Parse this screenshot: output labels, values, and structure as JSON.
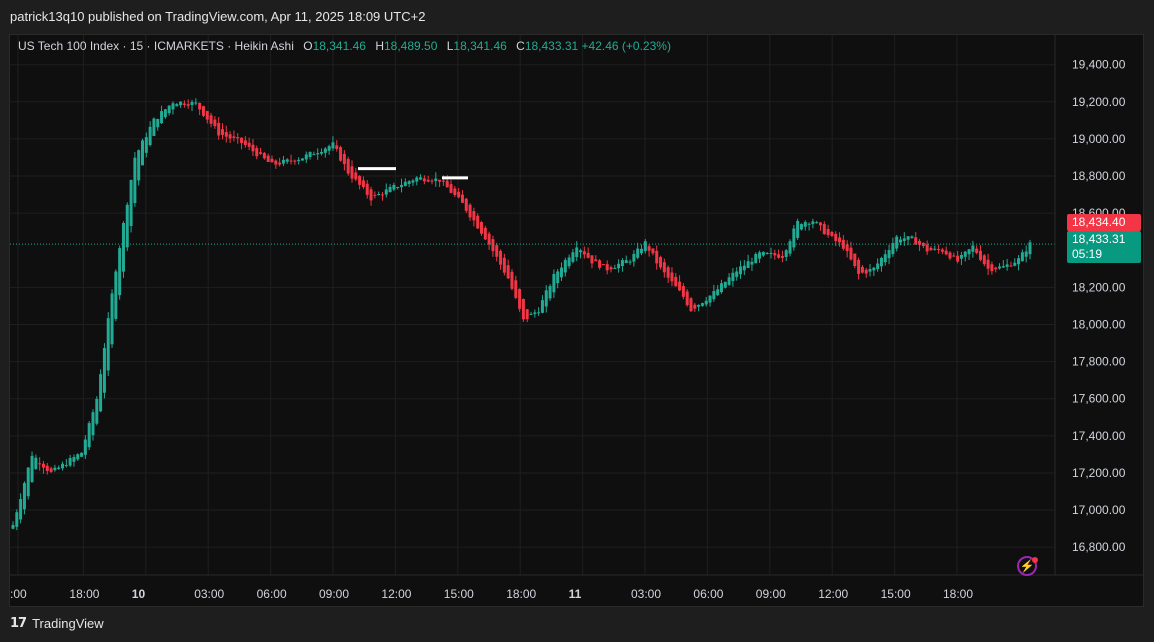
{
  "header": {
    "published": "patrick13q10 published on TradingView.com, Apr 11, 2025 18:09 UTC+2"
  },
  "legend": {
    "symbol": "US Tech 100 Index · 15 · ICMARKETS · Heikin Ashi",
    "o_label": "O",
    "o_value": "18,341.46",
    "h_label": "H",
    "h_value": "18,489.50",
    "l_label": "L",
    "l_value": "18,341.46",
    "c_label": "C",
    "c_value": "18,433.31",
    "change": "+42.46 (+0.23%)"
  },
  "price_tags": {
    "red_value": "18,434.40",
    "green_value": "18,433.31",
    "countdown": "05:19"
  },
  "footer": {
    "brand": "TradingView",
    "logo": "17"
  },
  "colors": {
    "up": "#22ab94",
    "down": "#f23645",
    "background": "#0f0f0f",
    "grid": "#1f1f1f"
  },
  "chart_data": {
    "type": "candlestick",
    "style": "Heikin Ashi",
    "interval": "15",
    "ylim": [
      16650,
      19560
    ],
    "y_ticks": [
      "19,400.00",
      "19,200.00",
      "19,000.00",
      "18,800.00",
      "18,600.00",
      "18,200.00",
      "18,000.00",
      "17,800.00",
      "17,600.00",
      "17,400.00",
      "17,200.00",
      "17,000.00",
      "16,800.00"
    ],
    "y_tick_values": [
      19400,
      19200,
      19000,
      18800,
      18600,
      18200,
      18000,
      17800,
      17600,
      17400,
      17200,
      17000,
      16800
    ],
    "x_ticks": [
      {
        "label": ":00",
        "bold": false
      },
      {
        "label": "18:00",
        "bold": false
      },
      {
        "label": "10",
        "bold": true
      },
      {
        "label": "03:00",
        "bold": false
      },
      {
        "label": "06:00",
        "bold": false
      },
      {
        "label": "09:00",
        "bold": false
      },
      {
        "label": "12:00",
        "bold": false
      },
      {
        "label": "15:00",
        "bold": false
      },
      {
        "label": "18:00",
        "bold": false
      },
      {
        "label": "11",
        "bold": true
      },
      {
        "label": "03:00",
        "bold": false
      },
      {
        "label": "06:00",
        "bold": false
      },
      {
        "label": "09:00",
        "bold": false
      },
      {
        "label": "12:00",
        "bold": false
      },
      {
        "label": "15:00",
        "bold": false
      },
      {
        "label": "18:00",
        "bold": false
      }
    ],
    "last_price": 18433.31,
    "horizontal_marks": [
      {
        "price": 18840,
        "label": "level-1"
      },
      {
        "price": 18790,
        "label": "level-2"
      }
    ],
    "anchors": [
      {
        "i": 0,
        "p": 16920
      },
      {
        "i": 5,
        "p": 17300
      },
      {
        "i": 10,
        "p": 17200
      },
      {
        "i": 18,
        "p": 17310
      },
      {
        "i": 22,
        "p": 17600
      },
      {
        "i": 27,
        "p": 18300
      },
      {
        "i": 32,
        "p": 18900
      },
      {
        "i": 37,
        "p": 19100
      },
      {
        "i": 42,
        "p": 19200
      },
      {
        "i": 48,
        "p": 19190
      },
      {
        "i": 54,
        "p": 19030
      },
      {
        "i": 60,
        "p": 18980
      },
      {
        "i": 68,
        "p": 18860
      },
      {
        "i": 76,
        "p": 18900
      },
      {
        "i": 84,
        "p": 18970
      },
      {
        "i": 88,
        "p": 18820
      },
      {
        "i": 94,
        "p": 18680
      },
      {
        "i": 100,
        "p": 18740
      },
      {
        "i": 106,
        "p": 18790
      },
      {
        "i": 112,
        "p": 18780
      },
      {
        "i": 118,
        "p": 18650
      },
      {
        "i": 124,
        "p": 18470
      },
      {
        "i": 130,
        "p": 18250
      },
      {
        "i": 134,
        "p": 18020
      },
      {
        "i": 138,
        "p": 18080
      },
      {
        "i": 142,
        "p": 18260
      },
      {
        "i": 148,
        "p": 18430
      },
      {
        "i": 152,
        "p": 18340
      },
      {
        "i": 156,
        "p": 18300
      },
      {
        "i": 162,
        "p": 18350
      },
      {
        "i": 166,
        "p": 18440
      },
      {
        "i": 170,
        "p": 18300
      },
      {
        "i": 176,
        "p": 18150
      },
      {
        "i": 178,
        "p": 18080
      },
      {
        "i": 184,
        "p": 18170
      },
      {
        "i": 190,
        "p": 18290
      },
      {
        "i": 196,
        "p": 18380
      },
      {
        "i": 202,
        "p": 18370
      },
      {
        "i": 206,
        "p": 18550
      },
      {
        "i": 210,
        "p": 18560
      },
      {
        "i": 214,
        "p": 18480
      },
      {
        "i": 218,
        "p": 18420
      },
      {
        "i": 222,
        "p": 18270
      },
      {
        "i": 226,
        "p": 18300
      },
      {
        "i": 232,
        "p": 18470
      },
      {
        "i": 236,
        "p": 18460
      },
      {
        "i": 240,
        "p": 18400
      },
      {
        "i": 244,
        "p": 18400
      },
      {
        "i": 248,
        "p": 18340
      },
      {
        "i": 252,
        "p": 18420
      },
      {
        "i": 256,
        "p": 18300
      },
      {
        "i": 260,
        "p": 18310
      },
      {
        "i": 264,
        "p": 18350
      },
      {
        "i": 267,
        "p": 18433
      }
    ]
  }
}
